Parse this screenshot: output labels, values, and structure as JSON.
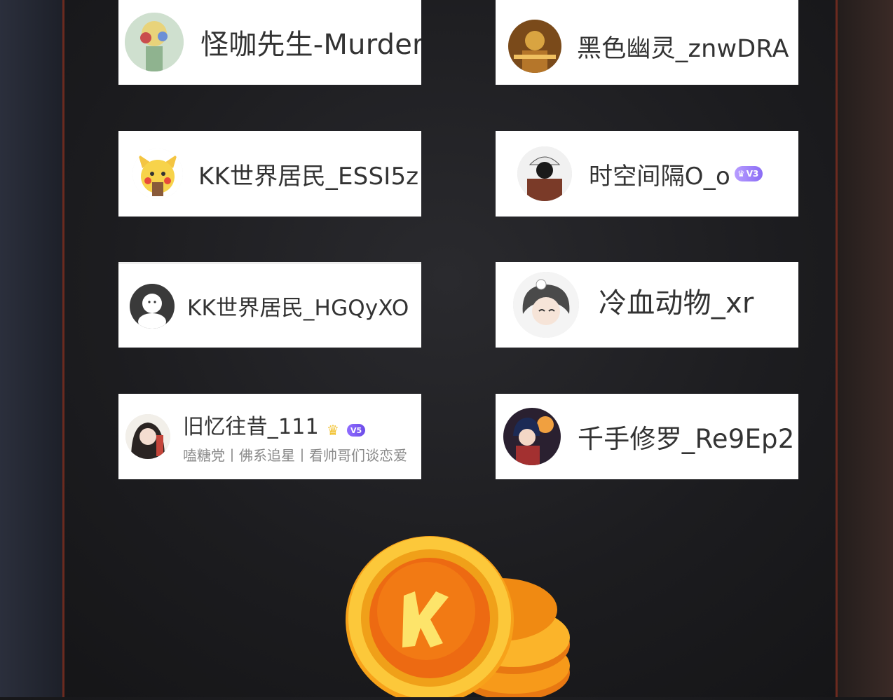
{
  "cards": [
    {
      "name": "怪咖先生-Murder"
    },
    {
      "name": "黑色幽灵_znwDRA"
    },
    {
      "name": "KK世界居民_ESSI5z"
    },
    {
      "name": "时空间隔O_o",
      "badge": "V3"
    },
    {
      "name": "KK世界居民_HGQyXO"
    },
    {
      "name": "冷血动物_xr"
    },
    {
      "name": "旧忆往昔_111",
      "badge": "V5",
      "subtitle": "嗑糖党丨佛系追星丨看帅哥们谈恋爱"
    },
    {
      "name": "千手修罗_Re9Ep2"
    }
  ],
  "icons": {
    "crown": "crown-icon",
    "coin": "k-coin-icon"
  },
  "colors": {
    "card_bg": "#ffffff",
    "text": "#333333",
    "subtitle": "#8a8a8a",
    "rail": "#6b2a1f",
    "vip_purple": "#8a6cf5",
    "coin_orange": "#f08a12"
  }
}
